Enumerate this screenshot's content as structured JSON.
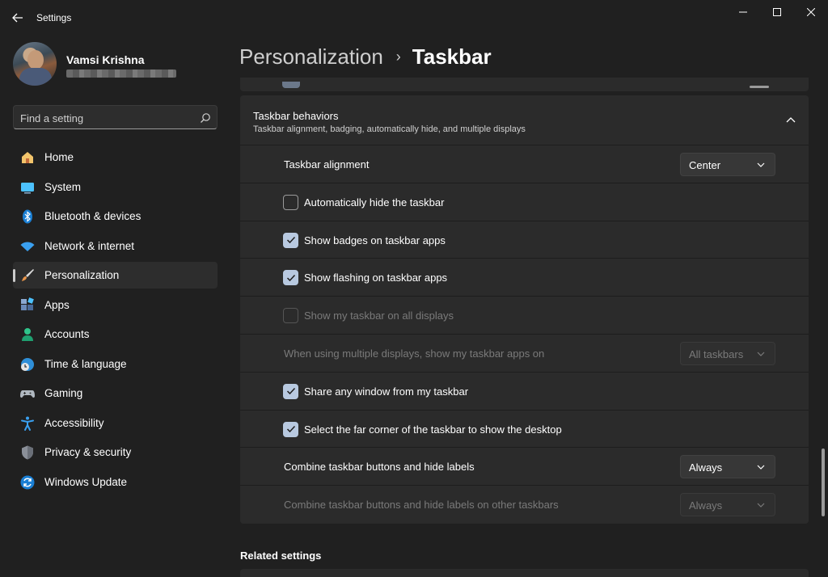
{
  "window": {
    "title": "Settings"
  },
  "profile": {
    "name": "Vamsi Krishna"
  },
  "search": {
    "placeholder": "Find a setting"
  },
  "sidebar": {
    "items": [
      {
        "label": "Home",
        "icon": "home-icon"
      },
      {
        "label": "System",
        "icon": "system-icon"
      },
      {
        "label": "Bluetooth & devices",
        "icon": "bluetooth-icon"
      },
      {
        "label": "Network & internet",
        "icon": "wifi-icon"
      },
      {
        "label": "Personalization",
        "icon": "paintbrush-icon",
        "active": true
      },
      {
        "label": "Apps",
        "icon": "apps-icon"
      },
      {
        "label": "Accounts",
        "icon": "person-icon"
      },
      {
        "label": "Time & language",
        "icon": "clock-globe-icon"
      },
      {
        "label": "Gaming",
        "icon": "gamepad-icon"
      },
      {
        "label": "Accessibility",
        "icon": "accessibility-icon"
      },
      {
        "label": "Privacy & security",
        "icon": "shield-icon"
      },
      {
        "label": "Windows Update",
        "icon": "update-icon"
      }
    ]
  },
  "breadcrumb": {
    "parent": "Personalization",
    "separator": "›",
    "current": "Taskbar"
  },
  "behaviors": {
    "title": "Taskbar behaviors",
    "subtitle": "Taskbar alignment, badging, automatically hide, and multiple displays",
    "alignment": {
      "label": "Taskbar alignment",
      "value": "Center"
    },
    "auto_hide": {
      "label": "Automatically hide the taskbar",
      "checked": false
    },
    "badges": {
      "label": "Show badges on taskbar apps",
      "checked": true
    },
    "flashing": {
      "label": "Show flashing on taskbar apps",
      "checked": true
    },
    "all_displays": {
      "label": "Show my taskbar on all displays",
      "checked": false,
      "disabled": true
    },
    "multi_display": {
      "label": "When using multiple displays, show my taskbar apps on",
      "value": "All taskbars",
      "disabled": true
    },
    "share_window": {
      "label": "Share any window from my taskbar",
      "checked": true
    },
    "far_corner": {
      "label": "Select the far corner of the taskbar to show the desktop",
      "checked": true
    },
    "combine": {
      "label": "Combine taskbar buttons and hide labels",
      "value": "Always"
    },
    "combine_other": {
      "label": "Combine taskbar buttons and hide labels on other taskbars",
      "value": "Always",
      "disabled": true
    }
  },
  "related": {
    "title": "Related settings"
  },
  "colors": {
    "accent": "#b8c9e0",
    "background": "#202020",
    "card": "#2b2b2b",
    "disabled_text": "#7a7a7a"
  }
}
